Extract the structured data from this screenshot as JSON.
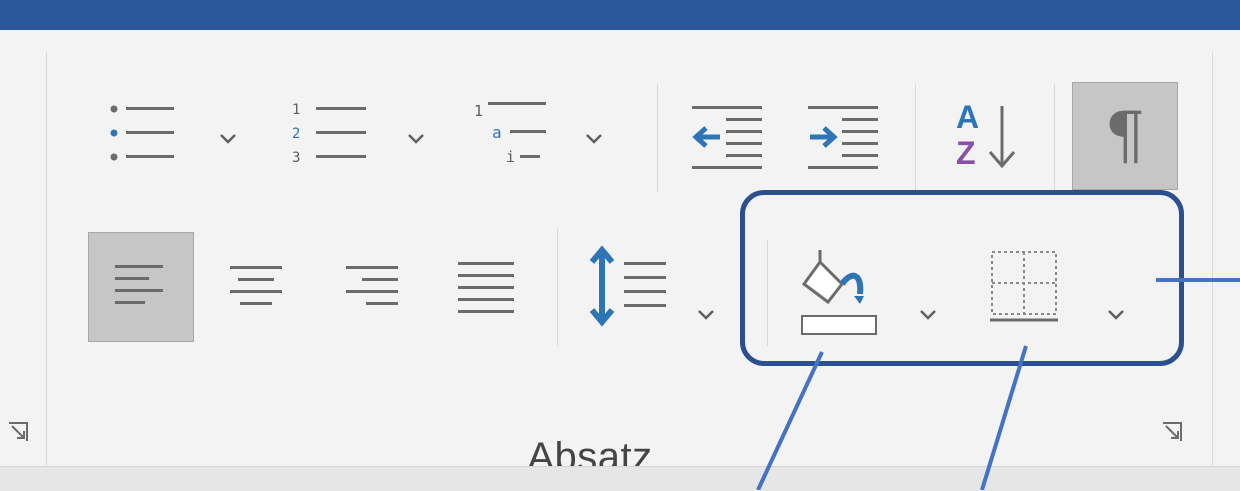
{
  "group": {
    "label": "Absatz"
  },
  "colors": {
    "title_bar": "#2b579a",
    "highlight_border": "#2b4f8f",
    "callout_line": "#4472c4",
    "icon_blue": "#2e75b6",
    "icon_gray": "#5f5f5f",
    "sort_purple": "#8b4fa8"
  },
  "toolbar": {
    "row1": [
      {
        "name": "bullets",
        "icon": "bullet-list-icon",
        "has_dropdown": true
      },
      {
        "name": "numbering",
        "icon": "numbered-list-icon",
        "has_dropdown": true
      },
      {
        "name": "multilevel-list",
        "icon": "multilevel-list-icon",
        "has_dropdown": true
      },
      {
        "name": "decrease-indent",
        "icon": "decrease-indent-icon"
      },
      {
        "name": "increase-indent",
        "icon": "increase-indent-icon"
      },
      {
        "name": "sort",
        "icon": "sort-az-icon"
      },
      {
        "name": "show-formatting-marks",
        "icon": "pilcrow-icon",
        "pressed": true
      }
    ],
    "row2": [
      {
        "name": "align-left",
        "icon": "align-left-icon",
        "pressed": true
      },
      {
        "name": "align-center",
        "icon": "align-center-icon"
      },
      {
        "name": "align-right",
        "icon": "align-right-icon"
      },
      {
        "name": "justify",
        "icon": "justify-icon"
      },
      {
        "name": "line-spacing",
        "icon": "line-spacing-icon",
        "has_dropdown": true
      },
      {
        "name": "shading",
        "icon": "paint-bucket-icon",
        "has_dropdown": true
      },
      {
        "name": "borders",
        "icon": "borders-icon",
        "has_dropdown": true
      }
    ]
  },
  "icon_text": {
    "numbering": [
      "1",
      "2",
      "3"
    ],
    "multilevel": [
      "1",
      "a",
      "i"
    ],
    "sort": [
      "A",
      "Z"
    ],
    "pilcrow": "¶"
  }
}
